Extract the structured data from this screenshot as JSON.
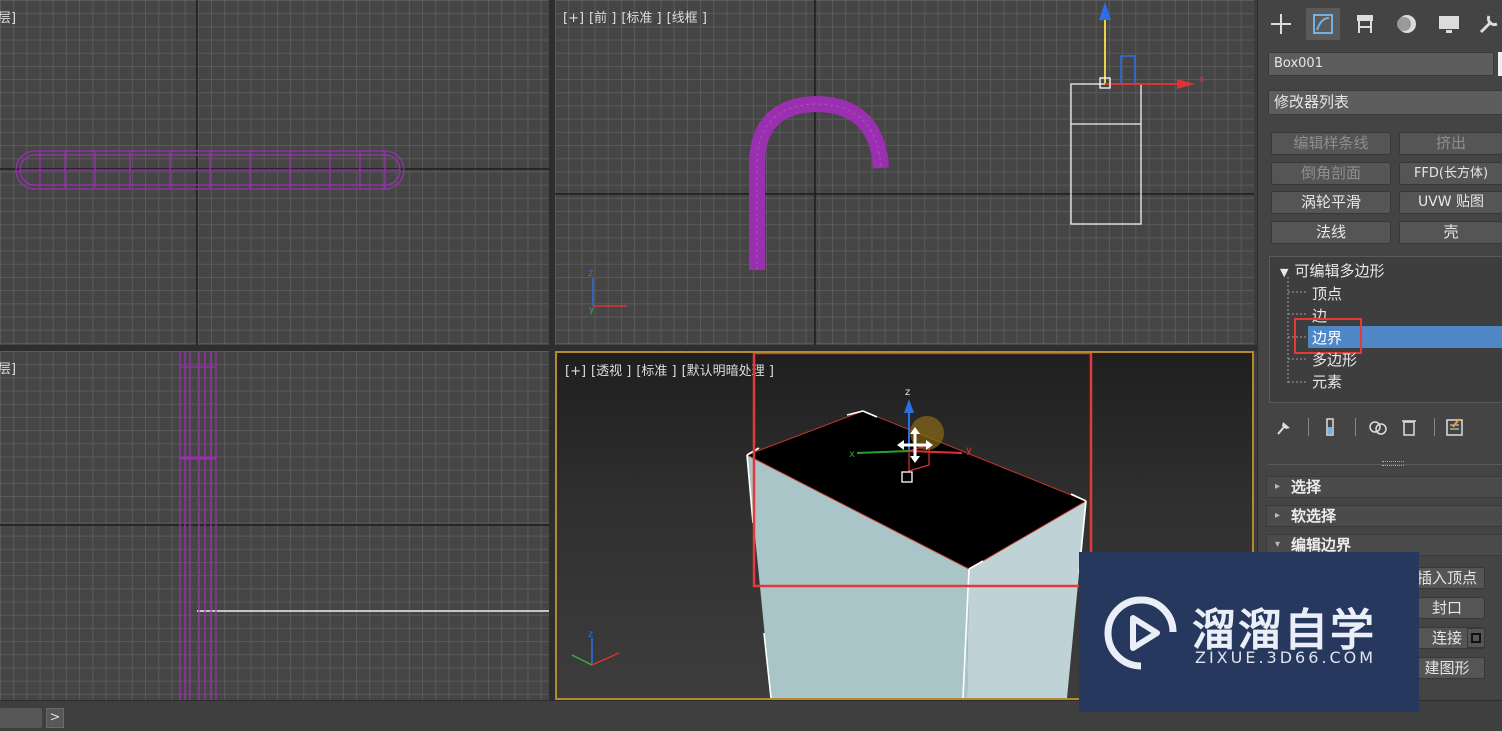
{
  "viewports": {
    "top_left": {
      "label": "层]"
    },
    "front": {
      "labels": [
        "[+]",
        "[前 ]",
        "[标准 ]",
        "[线框 ]"
      ]
    },
    "bottom_left": {
      "label": "层]"
    },
    "perspective": {
      "labels": [
        "[+]",
        "[透视 ]",
        "[标准 ]",
        "[默认明暗处理 ]"
      ]
    }
  },
  "axis_letters": {
    "x": "x",
    "y": "y",
    "z": "z"
  },
  "command_panel": {
    "tabs": [
      "create-icon",
      "modify-icon",
      "hierarchy-icon",
      "motion-icon",
      "display-icon",
      "utilities-icon"
    ],
    "object_name": "Box001",
    "modifier_list": "修改器列表",
    "modifier_buttons": [
      {
        "label": "编辑样条线",
        "dim": true
      },
      {
        "label": "挤出",
        "dim": true
      },
      {
        "label": "倒角剖面",
        "dim": true
      },
      {
        "label": "FFD(长方体)",
        "dim": false
      },
      {
        "label": "涡轮平滑",
        "dim": false
      },
      {
        "label": "UVW 贴图",
        "dim": false
      },
      {
        "label": "法线",
        "dim": false
      },
      {
        "label": "壳",
        "dim": false
      }
    ],
    "stack": {
      "root": "可编辑多边形",
      "items": [
        "顶点",
        "边",
        "边界",
        "多边形",
        "元素"
      ],
      "selected": "边界"
    },
    "rollouts": [
      "选择",
      "软选择",
      "编辑边界"
    ],
    "edit_border_buttons": [
      "插入顶点",
      "封口",
      "连接",
      "建图形"
    ]
  },
  "status_bar": {
    "arrow": ">"
  },
  "watermark": {
    "title": "溜溜自学",
    "subtitle": "ZIXUE.3D66.COM"
  },
  "colors": {
    "viewport_bg": "#454545",
    "grid": "#5a5a5a",
    "spline_purple": "#9a2fb0",
    "selection_highlight": "#4f86c6",
    "annotation_red": "#e03a3a",
    "active_viewport_border": "#b38b2e",
    "watermark_bg": "#27385e"
  }
}
